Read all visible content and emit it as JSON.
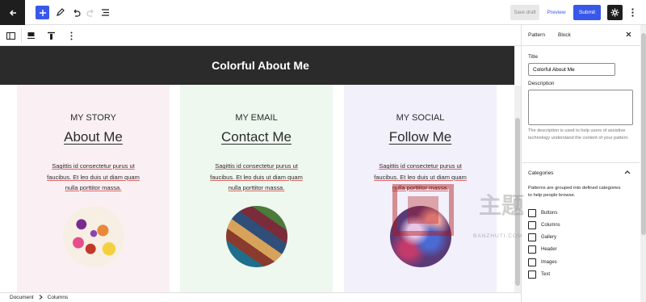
{
  "toolbar": {
    "save_draft": "Save draft",
    "preview": "Preview",
    "submit": "Submit",
    "accent_color": "#3858e9"
  },
  "icons": {
    "back": "wordpress-back-icon",
    "add": "plus-icon",
    "tools": "pencil-icon",
    "undo": "undo-icon",
    "redo": "redo-icon",
    "list_view": "list-view-icon",
    "settings": "gear-icon",
    "more": "vertical-dots-icon"
  },
  "canvas": {
    "hero_title": "Colorful About Me",
    "columns": [
      {
        "kicker": "MY STORY",
        "heading": "About Me",
        "body": "Sagittis id consectetur purus ut faucibus. Et leo duis ut diam quam nulla porttitor massa."
      },
      {
        "kicker": "MY EMAIL",
        "heading": "Contact Me",
        "body": "Sagittis id consectetur purus ut faucibus. Et leo duis ut diam quam nulla porttitor massa."
      },
      {
        "kicker": "MY SOCIAL",
        "heading": "Follow Me",
        "body": "Sagittis id consectetur purus ut faucibus. Et leo duis ut diam quam nulla porttitor massa."
      }
    ]
  },
  "breadcrumb": {
    "items": [
      "Document",
      "Columns"
    ]
  },
  "sidebar": {
    "tabs": [
      "Pattern",
      "Block"
    ],
    "title_label": "Title",
    "title_value": "Colorful About Me",
    "description_label": "Description",
    "description_value": "",
    "description_help": "The description is used to help users of assistive technology understand the content of your pattern.",
    "categories_label": "Categories",
    "categories_help": "Patterns are grouped into defined categories to help people browse.",
    "categories": [
      "Buttons",
      "Columns",
      "Gallery",
      "Header",
      "Images",
      "Text"
    ]
  },
  "watermark": {
    "brand_word": "主题",
    "url": "BANZHUTI.COM"
  }
}
